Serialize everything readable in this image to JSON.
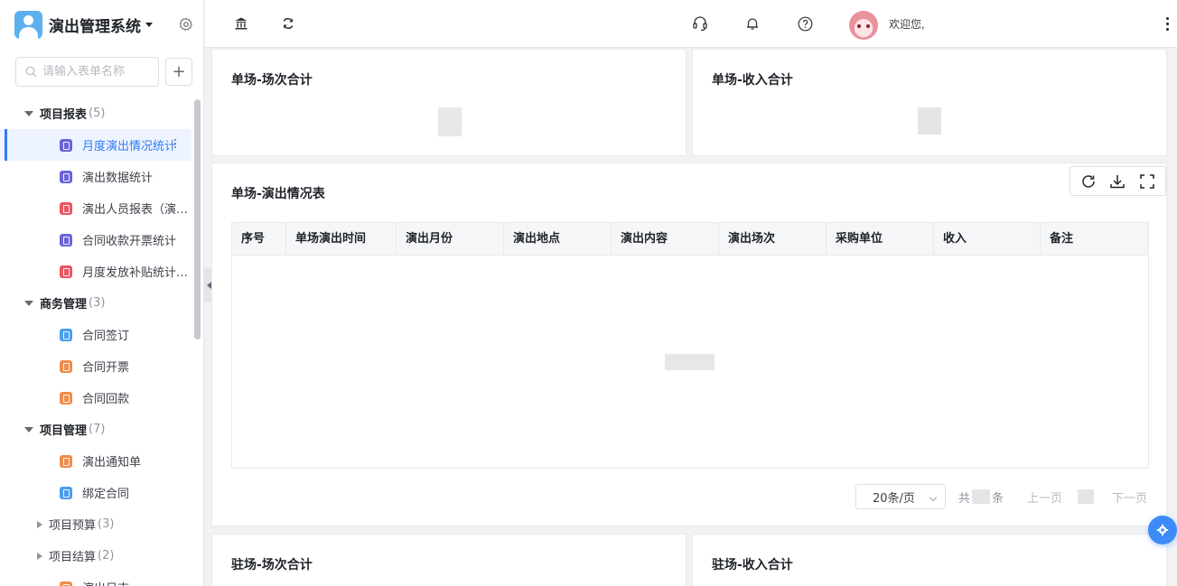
{
  "app": {
    "title": "演出管理系统"
  },
  "sidebar": {
    "search_placeholder": "请输入表单名称",
    "add_label": "+",
    "groups": [
      {
        "label": "项目报表",
        "count": "(5)"
      },
      {
        "label": "商务管理",
        "count": "(3)"
      },
      {
        "label": "项目管理",
        "count": "(7)"
      }
    ],
    "items": [
      {
        "label": "月度演出情况统计",
        "color": "#6b63d9"
      },
      {
        "label": "演出数据统计",
        "color": "#6b63d9"
      },
      {
        "label": "演出人员报表（演…",
        "color": "#ec5461"
      },
      {
        "label": "合同收款开票统计",
        "color": "#6b63d9"
      },
      {
        "label": "月度发放补贴统计…",
        "color": "#ec5461"
      },
      {
        "label": "合同签订",
        "color": "#4a9eef"
      },
      {
        "label": "合同开票",
        "color": "#f08d4a"
      },
      {
        "label": "合同回款",
        "color": "#f08d4a"
      },
      {
        "label": "演出通知单",
        "color": "#f08d4a"
      },
      {
        "label": "绑定合同",
        "color": "#4a9eef"
      },
      {
        "label": "演出日志",
        "color": "#f08d4a"
      }
    ],
    "sub_groups": [
      {
        "label": "项目预算",
        "count": "(3)"
      },
      {
        "label": "项目结算",
        "count": "(2)"
      }
    ]
  },
  "header": {
    "welcome": "欢迎您,"
  },
  "cards": {
    "top_left_title": "单场-场次合计",
    "top_right_title": "单场-收入合计",
    "table_title": "单场-演出情况表",
    "bottom_left_title": "驻场-场次合计",
    "bottom_right_title": "驻场-收入合计"
  },
  "table": {
    "columns": [
      "序号",
      "单场演出时间",
      "演出月份",
      "演出地点",
      "演出内容",
      "演出场次",
      "采购单位",
      "收入",
      "备注"
    ]
  },
  "pagination": {
    "page_size": "20条/页",
    "total_prefix": "共",
    "total_suffix": "条",
    "prev": "上一页",
    "next": "下一页"
  },
  "colors": {
    "accent": "#2f7bf5",
    "float_button": "#3d8bf7"
  }
}
